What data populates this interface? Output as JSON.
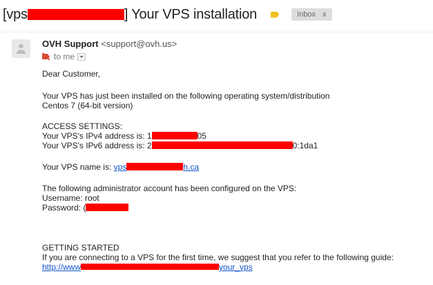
{
  "subject": {
    "prefix": "[vps",
    "suffix": "] Your VPS installation",
    "label_tag_color": "#f2c019",
    "inbox_chip": "Inbox",
    "inbox_close": "x"
  },
  "sender": {
    "name": "OVH Support",
    "email": "<support@ovh.us>",
    "to_me": "to me"
  },
  "body": {
    "greeting": "Dear Customer,",
    "intro_1": "Your VPS has just been installed on the following operating system/distribution",
    "intro_2": "Centos 7 (64-bit version)",
    "access_heading": "ACCESS SETTINGS:",
    "ipv4_label": "Your VPS's IPv4 address is: 1",
    "ipv4_end": "05",
    "ipv6_label": "Your VPS's IPv6 address is: 2",
    "ipv6_end": "0:1da1",
    "vps_name_label": "Your VPS name is: ",
    "vps_name_start": "vps",
    "vps_name_end": "h.ca",
    "admin_line": "The following administrator account has been configured on the VPS:",
    "username_line": "Username: root",
    "password_label": "Password: ",
    "password_start": "(",
    "getting_started": "GETTING STARTED",
    "guide_line": "If you are connecting to a VPS for the first time, we suggest that you refer to the following guide:",
    "guide_link_start": "http://www",
    "guide_link_end": "your_vps"
  },
  "colors": {
    "redaction": "#ff0000",
    "link": "#1155cc"
  }
}
